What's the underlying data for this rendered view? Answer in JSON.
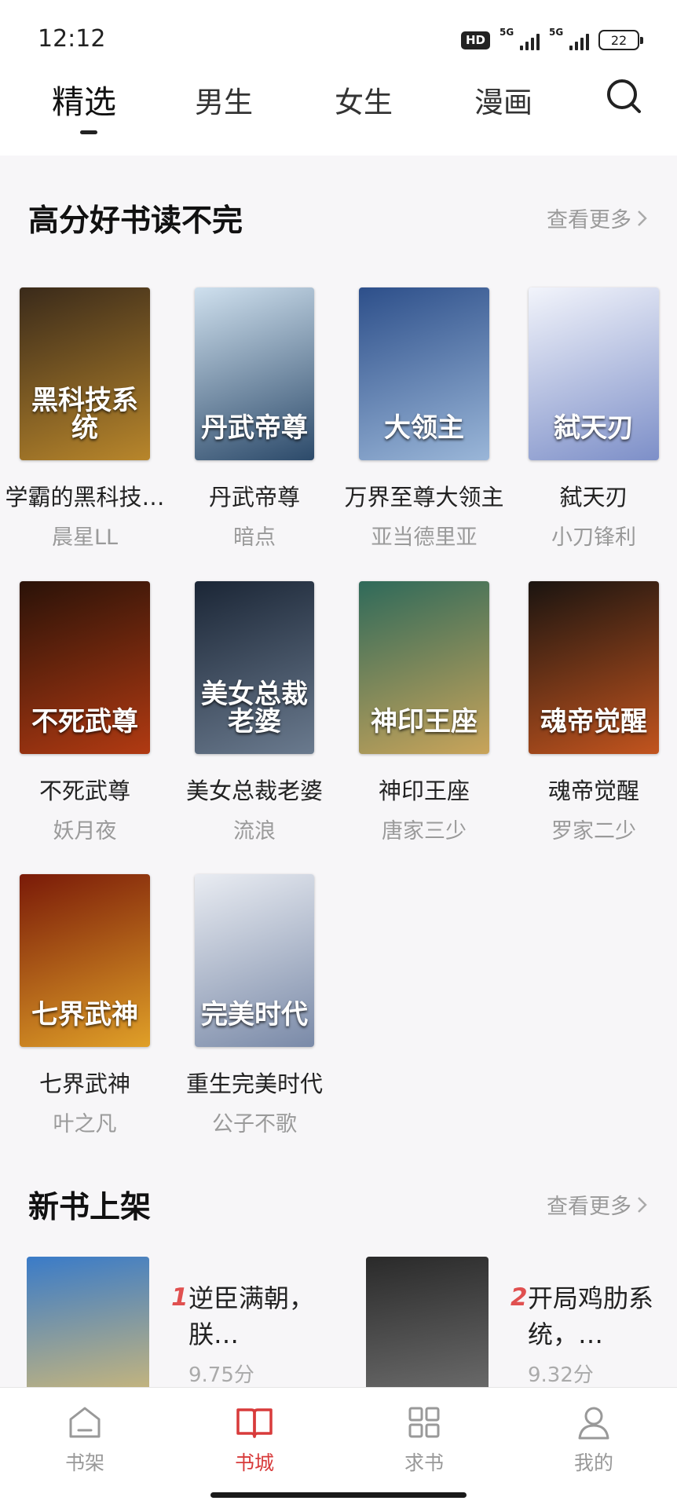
{
  "status_bar": {
    "time": "12:12",
    "hd": "HD",
    "sim1": "5G",
    "sim2": "5G",
    "battery": "22"
  },
  "top_tabs": [
    {
      "label": "精选",
      "active": true
    },
    {
      "label": "男生",
      "active": false
    },
    {
      "label": "女生",
      "active": false
    },
    {
      "label": "漫画",
      "active": false
    }
  ],
  "section_high_rated": {
    "title": "高分好书读不完",
    "more": "查看更多",
    "books": [
      {
        "name": "学霸的黑科技…",
        "author": "晨星LL",
        "cover_text": "黑科技系统",
        "cover_colors": [
          "#3a2a1a",
          "#b8862b"
        ]
      },
      {
        "name": "丹武帝尊",
        "author": "暗点",
        "cover_text": "丹武帝尊",
        "cover_colors": [
          "#cfe0ee",
          "#2c4a6a"
        ]
      },
      {
        "name": "万界至尊大领主",
        "author": "亚当德里亚",
        "cover_text": "大领主",
        "cover_colors": [
          "#2d4f8a",
          "#9ab6d8"
        ]
      },
      {
        "name": "弑天刃",
        "author": "小刀锋利",
        "cover_text": "弑天刃",
        "cover_colors": [
          "#f2f4fb",
          "#7d8fc8"
        ]
      },
      {
        "name": "不死武尊",
        "author": "妖月夜",
        "cover_text": "不死武尊",
        "cover_colors": [
          "#2a1208",
          "#b13a12"
        ]
      },
      {
        "name": "美女总裁老婆",
        "author": "流浪",
        "cover_text": "美女总裁老婆",
        "cover_colors": [
          "#1b2636",
          "#6a7a8e"
        ]
      },
      {
        "name": "神印王座",
        "author": "唐家三少",
        "cover_text": "神印王座",
        "cover_colors": [
          "#2f6a5a",
          "#c9a45a"
        ]
      },
      {
        "name": "魂帝觉醒",
        "author": "罗家二少",
        "cover_text": "魂帝觉醒",
        "cover_colors": [
          "#1a1410",
          "#c2541e"
        ]
      },
      {
        "name": "七界武神",
        "author": "叶之凡",
        "cover_text": "七界武神",
        "cover_colors": [
          "#7a1a08",
          "#e0a028"
        ]
      },
      {
        "name": "重生完美时代",
        "author": "公子不歌",
        "cover_text": "完美时代",
        "cover_colors": [
          "#e9ecf2",
          "#7a8aa8"
        ]
      }
    ]
  },
  "section_new": {
    "title": "新书上架",
    "more": "查看更多",
    "books": [
      {
        "rank": "1",
        "title": "逆臣满朝，朕…",
        "score": "9.75分",
        "cover_colors": [
          "#3a7bc8",
          "#e7c36b"
        ]
      },
      {
        "rank": "2",
        "title": "开局鸡肋系统，…",
        "score": "9.32分",
        "cover_colors": [
          "#2a2a2a",
          "#7a7a7a"
        ]
      }
    ]
  },
  "bottom_nav": [
    {
      "label": "书架",
      "icon": "bookshelf-icon",
      "active": false
    },
    {
      "label": "书城",
      "icon": "book-open-icon",
      "active": true
    },
    {
      "label": "求书",
      "icon": "grid-icon",
      "active": false
    },
    {
      "label": "我的",
      "icon": "user-icon",
      "active": false
    }
  ],
  "colors": {
    "accent": "#d83b3b",
    "muted": "#9a9a9a"
  }
}
